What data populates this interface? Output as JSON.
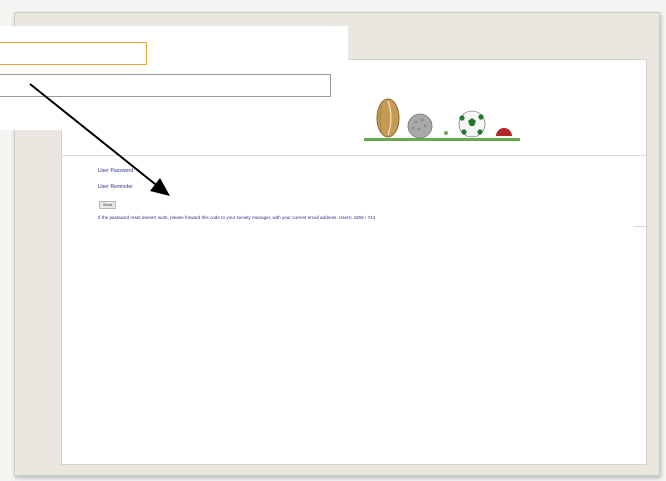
{
  "window": {
    "title": ""
  },
  "address_bar": {
    "value": "",
    "placeholder": ""
  },
  "search_bar": {
    "value": "",
    "placeholder": ""
  },
  "nav": {
    "links": [
      "User Password",
      "User Reminder"
    ]
  },
  "buttons": {
    "small_label": "Send"
  },
  "info": {
    "text": "If the password reset doesn't work, please forward this code to your society manager, with your current email address. Users: 4266 / 744"
  },
  "colors": {
    "accent": "#e3a73a",
    "link": "#2b2f8a",
    "frame": "#e9e7df",
    "page": "#ffffff",
    "arrow": "#000000"
  },
  "icons": {
    "decoration": [
      "rugby-ball-icon",
      "golf-ball-icon",
      "soccer-ball-icon",
      "cricket-ball-icon"
    ]
  }
}
